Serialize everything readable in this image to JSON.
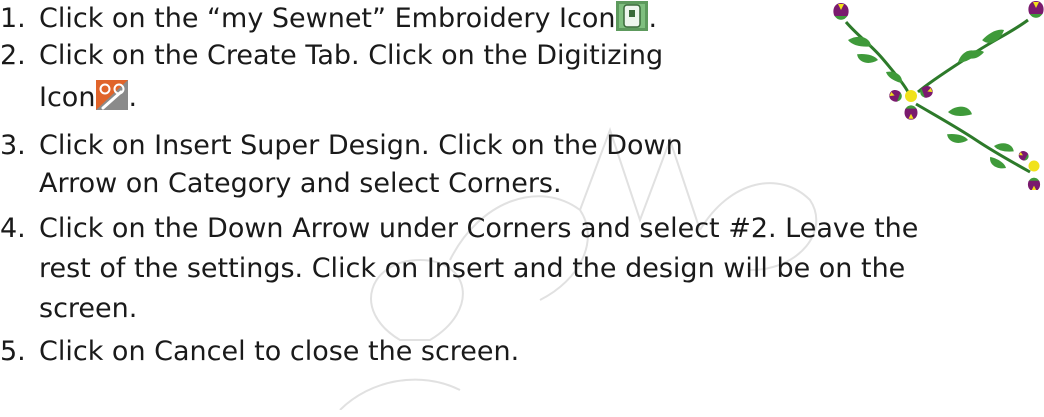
{
  "watermark": {
    "text": "Sew Sp",
    "color": "#c4c4c4"
  },
  "steps": [
    {
      "num": "1.",
      "lines": [
        "Click on the “my Sewnet” Embroidery Icon"
      ],
      "after_icon": ".",
      "icon": "sewnet-embroidery-icon"
    },
    {
      "num": "2.",
      "lines": [
        "Click on the Create Tab.  Click on the Digitizing",
        "Icon"
      ],
      "after_icon": ".",
      "icon": "digitizing-icon"
    },
    {
      "num": "3.",
      "lines": [
        "Click on Insert Super Design.  Click on the Down",
        "Arrow on Category and select Corners."
      ]
    },
    {
      "num": "4.",
      "lines": [
        "Click on the Down Arrow under Corners and select #2.  Leave the",
        "rest of the settings.  Click on Insert and the design will be on the",
        "screen."
      ]
    },
    {
      "num": "5.",
      "lines": [
        "Click on Cancel to close the screen."
      ]
    }
  ],
  "colors": {
    "text": "#1a1a1a",
    "leaf_green": "#3f9a3a",
    "petal_purple": "#7a1a6e",
    "center_yellow": "#f1e21a",
    "icon_green": "#5d9a5d",
    "icon_orange": "#e0642a"
  }
}
